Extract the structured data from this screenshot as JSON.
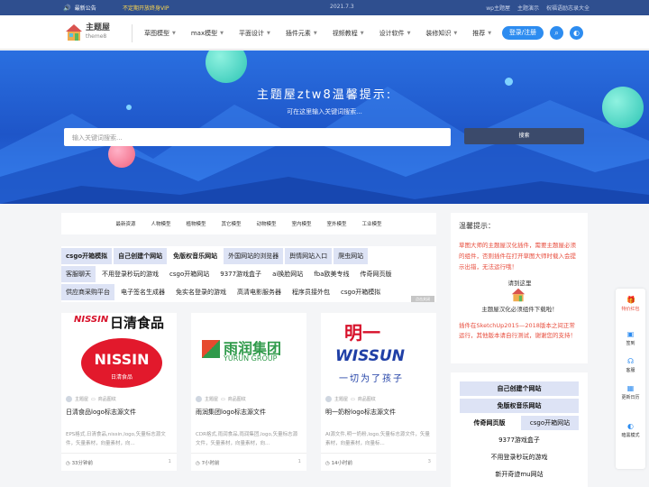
{
  "topbar": {
    "announce": "最新公告",
    "vip": "不定期开放终身VIP",
    "date": "2021.7.3",
    "links": [
      "wp主题屋",
      "主题演示",
      "祝福语励志录大全"
    ]
  },
  "logo": {
    "name": "主题屋",
    "sub": "theme8"
  },
  "menu": [
    {
      "label": "草图模型",
      "caret": true
    },
    {
      "label": "max模型",
      "caret": true
    },
    {
      "label": "平面设计",
      "caret": true
    },
    {
      "label": "插件元素",
      "caret": true
    },
    {
      "label": "视频教程",
      "caret": true
    },
    {
      "label": "设计软件",
      "caret": true
    },
    {
      "label": "装修知识",
      "caret": true
    },
    {
      "label": "推荐",
      "caret": true
    }
  ],
  "login": "登录/注册",
  "hero": {
    "title": "主题屋ztw8温馨提示:",
    "subtitle": "可在这里输入关键词搜索...",
    "placeholder": "输入关键词搜索...",
    "search_btn": "搜索"
  },
  "categories": [
    "最新资源",
    "人物模型",
    "植物模型",
    "其它模型",
    "动物模型",
    "室内模型",
    "室外模型",
    "工业模型"
  ],
  "tag_rows": [
    [
      {
        "t": "csgo开箱模拟",
        "h": true
      },
      {
        "t": "自己创建个网站",
        "h": true
      },
      {
        "t": "免版权音乐网站",
        "h": true
      },
      {
        "t": "外国网站的浏览器",
        "h": true
      },
      {
        "t": "舆情网站入口",
        "h": true
      },
      {
        "t": "爬虫网站",
        "h": true
      }
    ],
    [
      {
        "t": "客服聊天",
        "h": true
      },
      {
        "t": "不用登录秒玩的游戏",
        "h": false
      },
      {
        "t": "csgo开箱网站",
        "h": false
      },
      {
        "t": "9377游戏盒子",
        "h": false
      },
      {
        "t": "ai换脸网站",
        "h": false
      },
      {
        "t": "fba欧美专线",
        "h": false
      },
      {
        "t": "传奇网页版",
        "h": false
      }
    ],
    [
      {
        "t": "供应商采购平台",
        "h": true
      },
      {
        "t": "电子签名生成器",
        "h": false
      },
      {
        "t": "免实名登录的游戏",
        "h": false
      },
      {
        "t": "高清电影服务器",
        "h": false
      },
      {
        "t": "程序员接外包",
        "h": false
      },
      {
        "t": "csgo开箱模拟",
        "h": false
      }
    ]
  ],
  "cards": [
    {
      "brand_en": "NISSIN",
      "brand_cn": "日清食品",
      "author": "主题屋",
      "cat": "商品图纹",
      "title": "日清食品logo标志源文件",
      "desc": "EPS格式,日清食品,nissin,logo,矢量标志源文件，矢量素材，向量素材，向...",
      "time": "33分钟前",
      "count": "1"
    },
    {
      "brand_en": "YURUN GROUP",
      "brand_cn": "雨润集团",
      "author": "主题屋",
      "cat": "商品图纹",
      "title": "雨润集团logo标志源文件",
      "desc": "CDR格式,雨润食品,雨润集团,logo,矢量标志源文件，矢量素材，向量素材，向...",
      "time": "7小时前",
      "count": "1"
    },
    {
      "brand_en": "WISSUN",
      "brand_cn": "明一",
      "brand_slogan": "一切为了孩子",
      "author": "主题屋",
      "cat": "商品图纹",
      "title": "明一奶粉logo标志源文件",
      "desc": "AI源文件,明一奶粉,logo,矢量标志源文件，矢量素材，向量素材，向量标...",
      "time": "14小时前",
      "count": "3"
    }
  ],
  "sidebar_tip": {
    "title": "温馨提示：",
    "red1": "草图大师的主题屋汉化插件，需要主题屋必须的组件，否则插件在打开草图大师时载入会提示出错，无法运行哦！",
    "line2": "请到这里",
    "line3": "主题屋汉化必须组件下载啦！",
    "red2": "插件在SketchUp2015—2018版本之间正常运行，其他版本请自行测试，谢谢您的支持！"
  },
  "sidebar_tags": [
    {
      "t": "自己创建个网站",
      "h": true
    },
    {
      "t": "免版权音乐网站",
      "h": true
    },
    {
      "t": "传奇网页版",
      "h": true,
      "extra": "csgo开箱网站"
    },
    {
      "t": "9377游戏盒子",
      "h": false
    },
    {
      "t": "不用登录秒玩的游戏",
      "h": false
    },
    {
      "t": "新开奇迹mu网站",
      "h": false
    }
  ],
  "float": [
    {
      "label": "特价红包",
      "red": true
    },
    {
      "label": "签到",
      "red": false
    },
    {
      "label": "客服",
      "red": false
    },
    {
      "label": "更新日历",
      "red": false
    },
    {
      "label": "暗黑模式",
      "red": false
    }
  ],
  "tag_close": "点击关闭"
}
